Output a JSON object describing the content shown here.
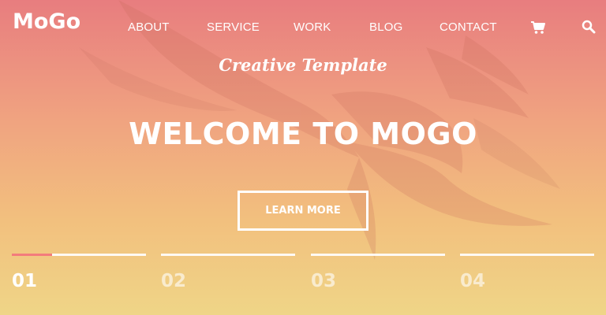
{
  "header": {
    "logo": "MoGo",
    "nav": {
      "about": "ABOUT",
      "service": "SERVICE",
      "work": "WORK",
      "blog": "BLOG",
      "contact": "CONTACT"
    },
    "icons": {
      "cart": "cart-icon",
      "search": "search-icon"
    }
  },
  "hero": {
    "subtitle": "Creative Template",
    "title": "WELCOME TO MOGO",
    "button": "LEARN MORE",
    "background": "eagle-image"
  },
  "slider": {
    "items": [
      "01",
      "02",
      "03",
      "04"
    ],
    "active_index": 0
  },
  "colors": {
    "gradient_top": "#e87d7f",
    "gradient_bottom": "#efd587",
    "accent": "#f37c7c",
    "text": "#ffffff"
  }
}
